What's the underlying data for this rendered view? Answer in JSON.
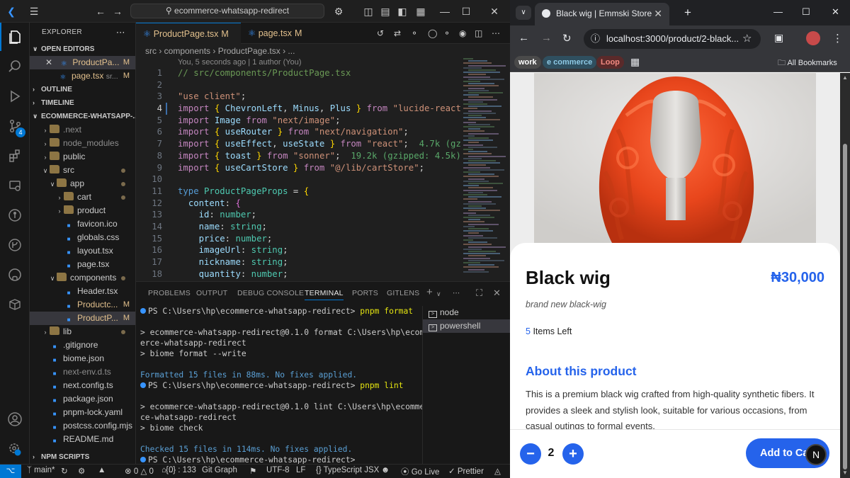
{
  "vscode": {
    "command_center": "ecommerce-whatsapp-redirect",
    "sidebar": {
      "title": "EXPLORER",
      "open_editors": "OPEN EDITORS",
      "open_files": [
        {
          "name": "ProductPa...",
          "desc": "",
          "mark": "M"
        },
        {
          "name": "page.tsx",
          "desc": "sr...",
          "mark": "M"
        }
      ],
      "outline": "OUTLINE",
      "timeline": "TIMELINE",
      "project": "ECOMMERCE-WHATSAPP-...",
      "tree": [
        {
          "label": ".next",
          "indent": 1,
          "kind": "folder",
          "color": "#8d8d8d"
        },
        {
          "label": "node_modules",
          "indent": 1,
          "kind": "folder",
          "color": "#8d8d8d"
        },
        {
          "label": "public",
          "indent": 1,
          "kind": "folder",
          "color": "#cccccc"
        },
        {
          "label": "src",
          "indent": 1,
          "kind": "folder-open",
          "color": "#cccccc"
        },
        {
          "label": "app",
          "indent": 2,
          "kind": "folder-open",
          "color": "#cccccc"
        },
        {
          "label": "cart",
          "indent": 3,
          "kind": "folder",
          "color": "#cccccc"
        },
        {
          "label": "product",
          "indent": 3,
          "kind": "folder",
          "color": "#cccccc"
        },
        {
          "label": "favicon.ico",
          "indent": 3,
          "kind": "file",
          "color": "#cccccc"
        },
        {
          "label": "globals.css",
          "indent": 3,
          "kind": "file",
          "color": "#cccccc"
        },
        {
          "label": "layout.tsx",
          "indent": 3,
          "kind": "file",
          "color": "#cccccc"
        },
        {
          "label": "page.tsx",
          "indent": 3,
          "kind": "file",
          "color": "#cccccc"
        },
        {
          "label": "components",
          "indent": 2,
          "kind": "folder-open",
          "color": "#cccccc"
        },
        {
          "label": "Header.tsx",
          "indent": 3,
          "kind": "file",
          "color": "#cccccc"
        },
        {
          "label": "Productc...",
          "indent": 3,
          "kind": "file",
          "color": "#e2c08d",
          "mark": "M"
        },
        {
          "label": "ProductP...",
          "indent": 3,
          "kind": "file",
          "color": "#e2c08d",
          "mark": "M",
          "selected": true
        },
        {
          "label": "lib",
          "indent": 1,
          "kind": "folder",
          "color": "#cccccc"
        },
        {
          "label": ".gitignore",
          "indent": 1,
          "kind": "file",
          "color": "#cccccc"
        },
        {
          "label": "biome.json",
          "indent": 1,
          "kind": "file",
          "color": "#cccccc"
        },
        {
          "label": "next-env.d.ts",
          "indent": 1,
          "kind": "file",
          "color": "#8d8d8d"
        },
        {
          "label": "next.config.ts",
          "indent": 1,
          "kind": "file",
          "color": "#cccccc"
        },
        {
          "label": "package.json",
          "indent": 1,
          "kind": "file",
          "color": "#cccccc"
        },
        {
          "label": "pnpm-lock.yaml",
          "indent": 1,
          "kind": "file",
          "color": "#cccccc"
        },
        {
          "label": "postcss.config.mjs",
          "indent": 1,
          "kind": "file",
          "color": "#cccccc"
        },
        {
          "label": "README.md",
          "indent": 1,
          "kind": "file",
          "color": "#cccccc"
        }
      ],
      "npm_scripts": "NPM SCRIPTS"
    },
    "tabs": [
      {
        "label": "ProductPage.tsx",
        "mark": "M",
        "active": true
      },
      {
        "label": "page.tsx",
        "mark": "M",
        "active": false
      }
    ],
    "breadcrumb": "src › components ›  ProductPage.tsx › ...",
    "blame": "You, 5 seconds ago | 1 author (You)",
    "code_lines": [
      "1",
      "2",
      "3",
      "4",
      "5",
      "6",
      "7",
      "8",
      "9",
      "10",
      "11",
      "12",
      "13",
      "14",
      "15",
      "16",
      "17",
      "18"
    ],
    "panel_tabs": [
      "PROBLEMS",
      "OUTPUT",
      "DEBUG CONSOLE",
      "TERMINAL",
      "PORTS",
      "GITLENS"
    ],
    "terminal": [
      {
        "t": "prompt",
        "text": "PS C:\\Users\\hp\\ecommerce-whatsapp-redirect> ",
        "cmd": "pnpm format"
      },
      {
        "t": "blank",
        "text": ""
      },
      {
        "t": "plain",
        "text": "> ecommerce-whatsapp-redirect@0.1.0 format C:\\Users\\hp\\ecomm"
      },
      {
        "t": "plain",
        "text": "erce-whatsapp-redirect"
      },
      {
        "t": "plain",
        "text": "> biome format --write"
      },
      {
        "t": "blank",
        "text": ""
      },
      {
        "t": "info",
        "text": "Formatted 15 files in 88ms. No fixes applied."
      },
      {
        "t": "prompt",
        "text": "PS C:\\Users\\hp\\ecommerce-whatsapp-redirect> ",
        "cmd": "pnpm lint"
      },
      {
        "t": "blank",
        "text": ""
      },
      {
        "t": "plain",
        "text": "> ecommerce-whatsapp-redirect@0.1.0 lint C:\\Users\\hp\\ecommer"
      },
      {
        "t": "plain",
        "text": "ce-whatsapp-redirect"
      },
      {
        "t": "plain",
        "text": "> biome check"
      },
      {
        "t": "blank",
        "text": ""
      },
      {
        "t": "info",
        "text": "Checked 15 files in 114ms. No fixes applied."
      },
      {
        "t": "prompt",
        "text": "PS C:\\Users\\hp\\ecommerce-whatsapp-redirect> ",
        "cmd": ""
      }
    ],
    "terminal_list": [
      "node",
      "powershell"
    ],
    "status": {
      "branch": "main*",
      "errors": "0",
      "warnings": "0",
      "ports": "0",
      "selection": "{..} : 133",
      "git_graph": "Git Graph",
      "encoding": "UTF-8",
      "eol": "LF",
      "language": "TypeScript JSX",
      "go_live": "Go Live",
      "prettier": "Prettier"
    }
  },
  "chrome": {
    "tab_title": "Black wig | Emmski Store",
    "url": "localhost:3000/product/2-black...",
    "bookmarks": [
      {
        "label": "work",
        "bg": "#4a4a4a",
        "fg": "#ffffff"
      },
      {
        "label": "e commerce",
        "bg": "#2f4f5f",
        "fg": "#8ecae6"
      },
      {
        "label": "Loop",
        "bg": "#5a2a2a",
        "fg": "#f28b82"
      }
    ],
    "all_bookmarks": "All Bookmarks",
    "product": {
      "name": "Black wig",
      "price": "₦30,000",
      "nickname": "brand new black-wig",
      "quantity_left": "5",
      "items_left_label": "Items Left",
      "about_heading": "About this product",
      "description": "This is a premium black wig crafted from high-quality synthetic fibers. It provides a sleek and stylish look, suitable for various occasions, from casual outings to formal events.",
      "qty": "2",
      "add_to_cart": "Add to Cart",
      "avatar_letter": "N"
    }
  },
  "colors": {
    "accent": "#2563eb",
    "vscode_blue": "#0078d4"
  }
}
